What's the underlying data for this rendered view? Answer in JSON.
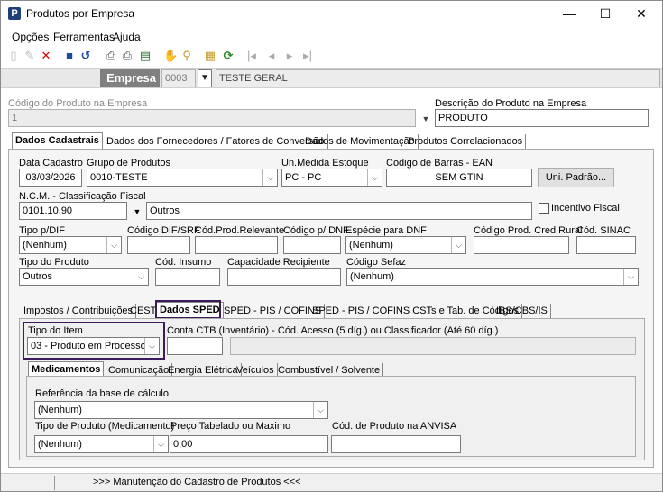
{
  "window": {
    "title": "Produtos por Empresa",
    "minimize": "—",
    "maximize": "☐",
    "close": "✕",
    "app_icon": "P"
  },
  "menu": [
    "Opções",
    "Ferramentas",
    "Ajuda"
  ],
  "toolbar_icons": [
    "new-doc-icon",
    "edit-icon",
    "delete-icon",
    "save-icon",
    "undo-icon",
    "print-icon",
    "print-preview-icon",
    "export-icon",
    "hand-icon",
    "search-icon",
    "properties-icon",
    "refresh-icon",
    "first-icon",
    "prev-icon",
    "next-icon",
    "last-icon"
  ],
  "empresa": {
    "label": "Empresa",
    "code": "0003",
    "name": "TESTE GERAL"
  },
  "produto": {
    "code_label": "Código do Produto na Empresa",
    "code": "1",
    "desc_label": "Descrição do Produto na Empresa",
    "desc": "PRODUTO"
  },
  "main_tabs": [
    "Dados Cadastrais",
    "Dados dos Fornecedores / Fatores de Conversão",
    "Dados de Movimentação",
    "Produtos Correlacionados"
  ],
  "cad": {
    "data_cadastro_label": "Data Cadastro",
    "data_cadastro": "03/03/2026",
    "grupo_label": "Grupo de Produtos",
    "grupo": "0010-TESTE",
    "um_label": "Un.Medida Estoque",
    "um": "PC - PC",
    "ean_label": "Codigo de Barras - EAN",
    "ean": "SEM GTIN",
    "uni_padrao": "Uni. Padrão...",
    "ncm_label": "N.C.M.  -  Classificação Fiscal",
    "ncm": "0101.10.90",
    "ncm_desc": "Outros",
    "incentivo_label": "Incentivo Fiscal",
    "tipo_dif_label": "Tipo p/DIF",
    "tipo_dif": "(Nenhum)",
    "cod_dif_label": "Código DIF/SRF",
    "cod_relev_label": "Cód.Prod.Relevante",
    "cod_dnf_label": "Código p/ DNF",
    "especie_dnf_label": "Espécie para DNF",
    "especie_dnf": "(Nenhum)",
    "cred_rural_label": "Código Prod. Cred Rural",
    "sinac_label": "Cód. SINAC",
    "tipo_produto_label": "Tipo do Produto",
    "tipo_produto": "Outros",
    "insumo_label": "Cód. Insumo",
    "capacidade_label": "Capacidade Recipiente",
    "sefaz_label": "Código Sefaz",
    "sefaz": "(Nenhum)"
  },
  "sub_tabs": [
    "Impostos / Contribuições",
    "CEST",
    "Dados SPED",
    "SPED - PIS / COFINS",
    "SPED - PIS / COFINS CSTs e Tab. de Códigos",
    "IBS/CBS/IS"
  ],
  "sped": {
    "tipo_item_label": "Tipo do Item",
    "tipo_item": "03 - Produto em Processo",
    "conta_label": "Conta CTB (Inventário) - Cód. Acesso (5 díg.) ou Classificador (Até 60 díg.)"
  },
  "inner_tabs": [
    "Medicamentos",
    "Comunicação",
    "Energia Elétrica",
    "Veículos",
    "Combustível / Solvente"
  ],
  "med": {
    "ref_label": "Referência da base de cálculo",
    "ref": "(Nenhum)",
    "tipo_label": "Tipo de Produto (Medicamento)",
    "tipo": "(Nenhum)",
    "preco_label": "Preço Tabelado ou Maximo",
    "preco": "0,00",
    "anvisa_label": "Cód. de Produto na ANVISA"
  },
  "status": {
    "text": ">>> Manutenção do Cadastro de Produtos <<<"
  }
}
